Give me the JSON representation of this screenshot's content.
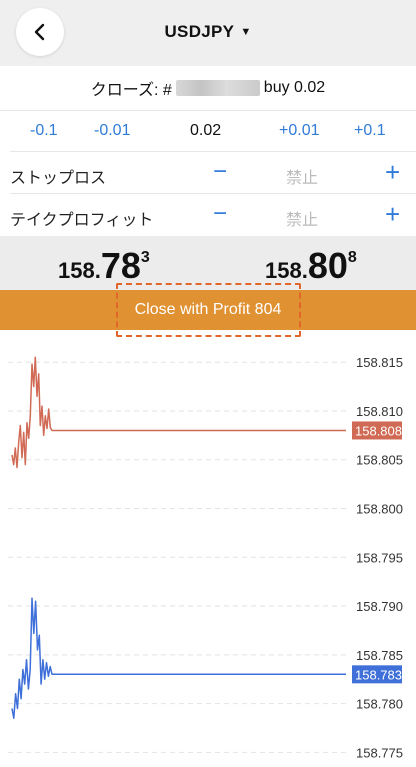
{
  "header": {
    "symbol": "USDJPY",
    "caret": "▼"
  },
  "close_row": {
    "prefix": "クローズ: #",
    "suffix": "buy 0.02"
  },
  "volume": {
    "minus_large": "-0.1",
    "minus_small": "-0.01",
    "value": "0.02",
    "plus_small": "+0.01",
    "plus_large": "+0.1"
  },
  "stop_loss": {
    "label": "ストップロス",
    "minus": "−",
    "value": "禁止",
    "plus": "+"
  },
  "take_profit": {
    "label": "テイクプロフィット",
    "minus": "−",
    "value": "禁止",
    "plus": "+"
  },
  "prices": {
    "bid": {
      "prefix": "158.",
      "big": "78",
      "sup": "3"
    },
    "ask": {
      "prefix": "158.",
      "big": "80",
      "sup": "8"
    }
  },
  "close_button": {
    "label": "Close with Profit 804"
  },
  "colors": {
    "accent": "#e09131",
    "link_blue": "#2f7bd8",
    "ask_line": "#d06a55",
    "bid_line": "#3f6fd8",
    "highlight_dash": "#e0662a"
  },
  "chart_data": {
    "type": "line",
    "y_ticks": [
      "158.815",
      "158.810",
      "158.805",
      "158.800",
      "158.795",
      "158.790",
      "158.785",
      "158.780",
      "158.775"
    ],
    "ylim": [
      158.7735,
      158.8183
    ],
    "grid": true,
    "series": [
      {
        "values": [
          158.8055,
          158.8045,
          158.8062,
          158.8042,
          158.8068,
          158.8085,
          158.8052,
          158.8078,
          158.8045,
          158.8088,
          158.8072,
          158.8095,
          158.8148,
          158.8125,
          158.8155,
          158.8115,
          158.8138,
          158.8085,
          158.8105,
          158.8075,
          158.8095,
          158.8082,
          158.8102,
          158.8083,
          158.808,
          158.808,
          158.808
        ],
        "last_label": "158.808"
      },
      {
        "values": [
          158.7795,
          158.7785,
          158.781,
          158.7795,
          158.7825,
          158.7805,
          158.7835,
          158.782,
          158.7845,
          158.7815,
          158.7835,
          158.7908,
          158.7872,
          158.7905,
          158.7855,
          158.787,
          158.782,
          158.7845,
          158.7825,
          158.7842,
          158.7828,
          158.7838,
          158.783,
          158.783,
          158.783
        ],
        "last_label": "158.783"
      }
    ]
  }
}
